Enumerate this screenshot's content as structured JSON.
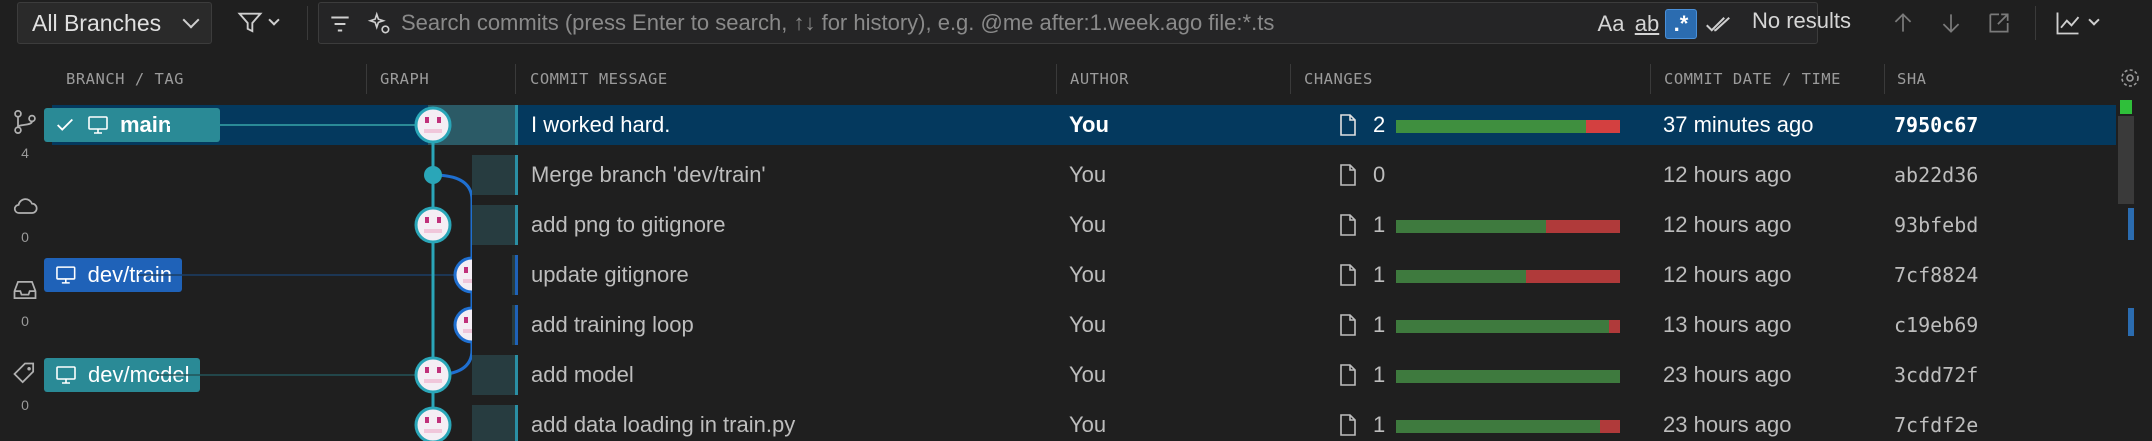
{
  "toolbar": {
    "branch_select": "All Branches",
    "search_placeholder": "Search commits (press Enter to search, ↑↓ for history), e.g. @me after:1.week.ago file:*.ts",
    "search_value": "",
    "match_case": "Aa",
    "match_word": "ab",
    "regex": ".*",
    "no_results": "No results"
  },
  "columns": {
    "branch": "BRANCH / TAG",
    "graph": "GRAPH",
    "message": "COMMIT MESSAGE",
    "author": "AUTHOR",
    "changes": "CHANGES",
    "date": "COMMIT DATE / TIME",
    "sha": "SHA"
  },
  "activity": {
    "branches_count": "4",
    "remotes_count": "0",
    "stashes_count": "0",
    "tags_count": "0"
  },
  "branches": {
    "main": "main",
    "train": "dev/train",
    "model": "dev/model"
  },
  "commits": [
    {
      "message": "I worked hard.",
      "author": "You",
      "files": "2",
      "date": "37 minutes ago",
      "sha": "7950c67",
      "added": 0.85,
      "deleted": 0.15
    },
    {
      "message": "Merge branch 'dev/train'",
      "author": "You",
      "files": "0",
      "date": "12 hours ago",
      "sha": "ab22d36",
      "added": 0,
      "deleted": 0
    },
    {
      "message": "add png to gitignore",
      "author": "You",
      "files": "1",
      "date": "12 hours ago",
      "sha": "93bfebd",
      "added": 0.67,
      "deleted": 0.33
    },
    {
      "message": "update gitignore",
      "author": "You",
      "files": "1",
      "date": "12 hours ago",
      "sha": "7cf8824",
      "added": 0.58,
      "deleted": 0.42
    },
    {
      "message": "add training loop",
      "author": "You",
      "files": "1",
      "date": "13 hours ago",
      "sha": "c19eb69",
      "added": 0.95,
      "deleted": 0.05
    },
    {
      "message": "add model",
      "author": "You",
      "files": "1",
      "date": "23 hours ago",
      "sha": "3cdd72f",
      "added": 1.0,
      "deleted": 0
    },
    {
      "message": "add data loading in train.py",
      "author": "You",
      "files": "1",
      "date": "23 hours ago",
      "sha": "7cfdf2e",
      "added": 0.91,
      "deleted": 0.09
    }
  ],
  "colors": {
    "accent": "#2a8a96",
    "selected_row": "#04395e",
    "branch_train": "#1f62b8",
    "added": "#3e7a3e",
    "deleted": "#b03a3a"
  }
}
